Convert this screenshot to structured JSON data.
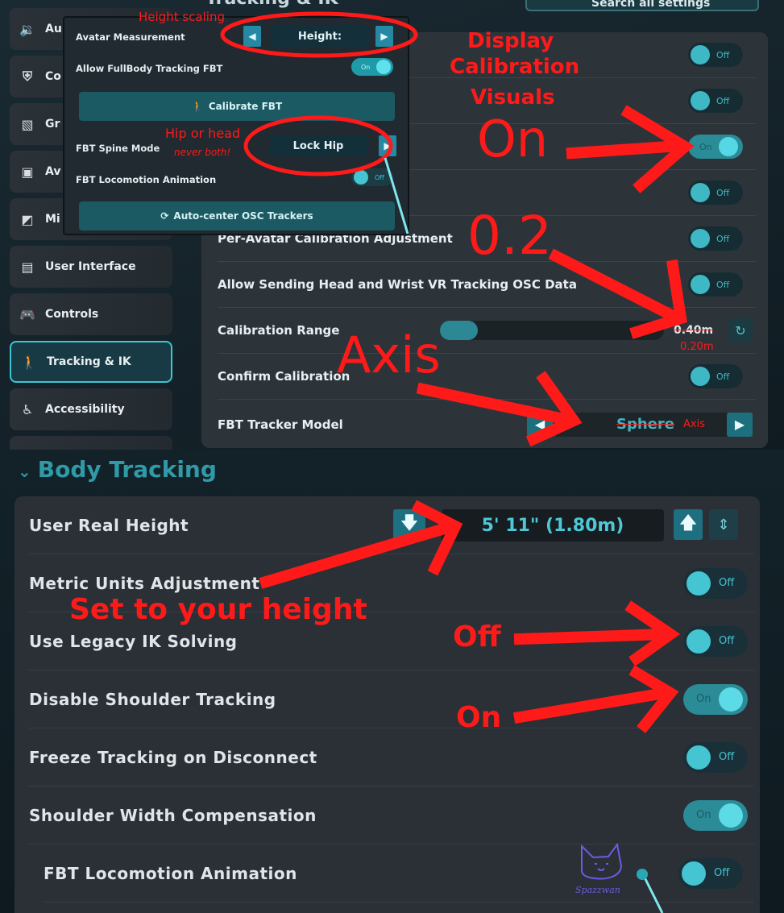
{
  "header": {
    "title": "Tracking & IK",
    "search_label": "Search all settings"
  },
  "sidebar": {
    "items": [
      {
        "label": "Au",
        "icon": "speaker-icon"
      },
      {
        "label": "Co",
        "icon": "shield-icon"
      },
      {
        "label": "Gr",
        "icon": "image-icon"
      },
      {
        "label": "Av",
        "icon": "avatar-icon"
      },
      {
        "label": "Mi",
        "icon": "misc-icon"
      },
      {
        "label": "User Interface",
        "icon": "monitor-icon"
      },
      {
        "label": "Controls",
        "icon": "gamepad-icon"
      },
      {
        "label": "Tracking & IK",
        "icon": "person-icon",
        "active": true
      },
      {
        "label": "Accessibility",
        "icon": "accessibility-icon"
      }
    ]
  },
  "popup": {
    "avatar_measurement_label": "Avatar Measurement",
    "avatar_measurement_value": "Height:",
    "allow_fbt_label": "Allow FullBody Tracking FBT",
    "allow_fbt_toggle": "On",
    "calibrate_button": "Calibrate FBT",
    "spine_mode_label": "FBT Spine Mode",
    "spine_mode_value": "Lock Hip",
    "locomotion_label": "FBT Locomotion Animation",
    "locomotion_toggle": "Off",
    "autocenter_button": "Auto-center OSC Trackers"
  },
  "settings": {
    "rows": [
      {
        "label": "",
        "toggle": "Off"
      },
      {
        "label": "",
        "toggle": "Off"
      },
      {
        "label": "",
        "toggle": "On"
      },
      {
        "label": "",
        "toggle": "Off"
      },
      {
        "label": "Per-Avatar Calibration Adjustment",
        "toggle": "Off"
      },
      {
        "label": "Allow Sending Head and Wrist VR Tracking OSC Data",
        "toggle": "Off"
      }
    ],
    "calibration_range": {
      "label": "Calibration Range",
      "value": "0.40m",
      "fill_fraction": 0.17
    },
    "confirm_calibration": {
      "label": "Confirm Calibration",
      "toggle": "Off"
    },
    "tracker_model": {
      "label": "FBT Tracker Model",
      "value": "Sphere"
    }
  },
  "body_tracking": {
    "section_title": "Body Tracking",
    "user_real_height": {
      "label": "User Real Height",
      "value": "5' 11\" (1.80m)"
    },
    "rows": [
      {
        "label": "Metric Units Adjustment",
        "toggle": "Off"
      },
      {
        "label": "Use Legacy IK Solving",
        "toggle": "Off"
      },
      {
        "label": "Disable Shoulder Tracking",
        "toggle": "On"
      },
      {
        "label": "Freeze Tracking on Disconnect",
        "toggle": "Off"
      },
      {
        "label": "Shoulder Width Compensation",
        "toggle": "On"
      },
      {
        "label": "FBT Locomotion Animation",
        "toggle": "Off"
      }
    ]
  },
  "annotations": {
    "height_scaling": "Height scaling",
    "display_calibration_visuals": [
      "Display",
      "Calibration",
      "Visuals"
    ],
    "on_top": "On",
    "hip_or_head": "Hip or head",
    "never_both": "never both!",
    "point_two": "0.2",
    "range_correction": "0.20m",
    "axis_big": "Axis",
    "axis_small": "Axis",
    "set_height": "Set to your height",
    "off_label": "Off",
    "on_label": "On",
    "signature": "Spazzwan",
    "annotation_color": "#ff1a1a"
  }
}
